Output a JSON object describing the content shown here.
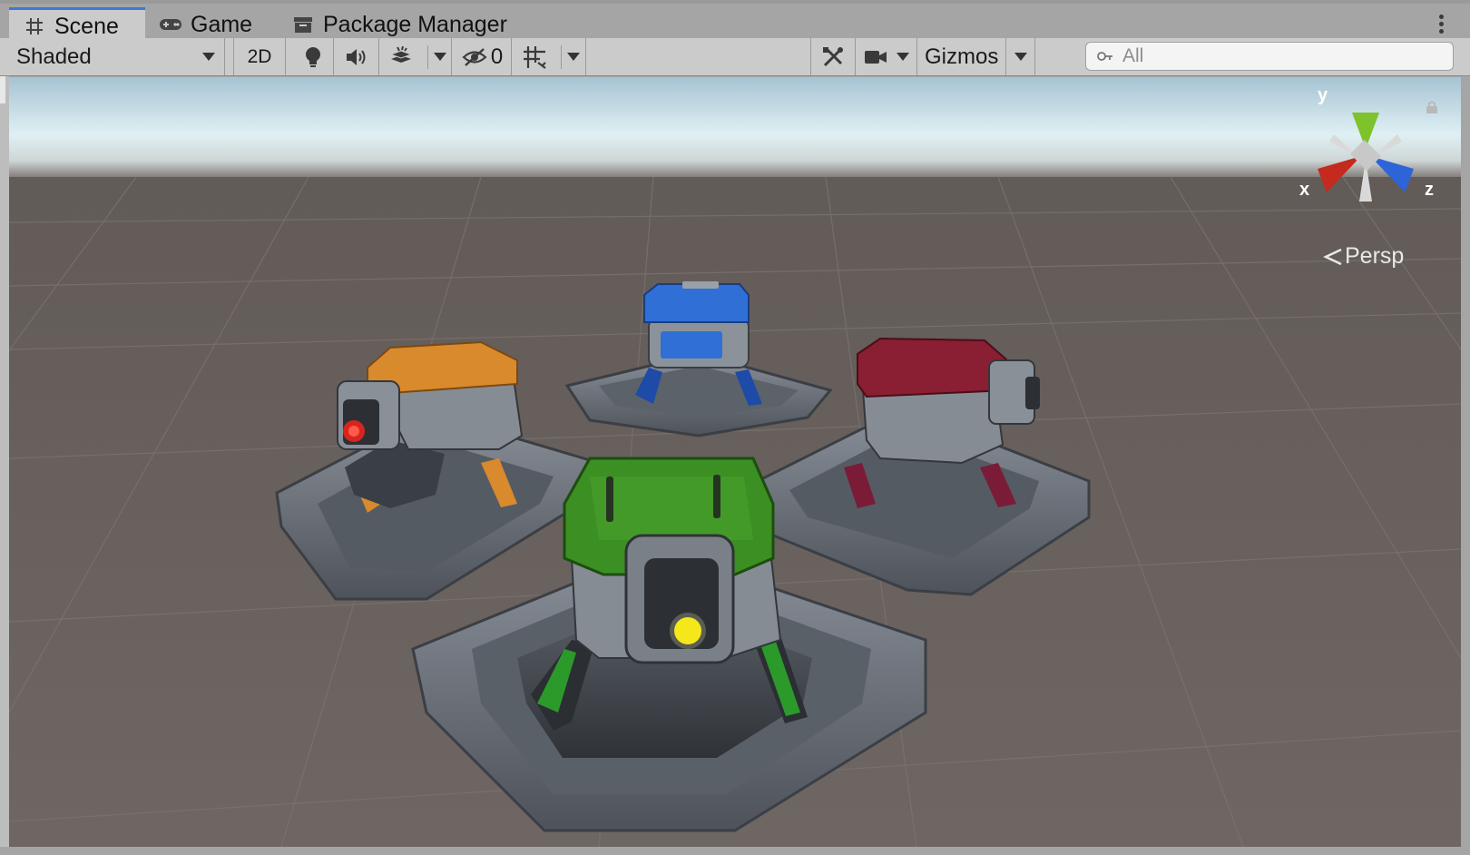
{
  "tabs": [
    {
      "label": "Scene",
      "icon": "hash-grid-icon",
      "active": true
    },
    {
      "label": "Game",
      "icon": "gamepad-icon",
      "active": false
    },
    {
      "label": "Package Manager",
      "icon": "package-icon",
      "active": false
    }
  ],
  "toolbar": {
    "draw_mode": "Shaded",
    "toggle_2d": "2D",
    "hidden_count": "0",
    "gizmos_label": "Gizmos"
  },
  "search": {
    "placeholder": "All"
  },
  "scene_view": {
    "projection_label": "Persp",
    "axis_labels": {
      "x": "x",
      "y": "y",
      "z": "z"
    },
    "turrets": [
      {
        "color_name": "orange",
        "accent": "#d98a2c"
      },
      {
        "color_name": "blue",
        "accent": "#2f6fd6"
      },
      {
        "color_name": "red",
        "accent": "#8a1e33"
      },
      {
        "color_name": "green",
        "accent": "#3c8f22"
      }
    ]
  },
  "colors": {
    "tab_active_accent": "#3a79d7",
    "sky_top": "#a9c4d4",
    "ground": "#6b6460",
    "axis_x": "#c42a1e",
    "axis_y": "#7cc32c",
    "axis_z": "#2e64d8"
  }
}
